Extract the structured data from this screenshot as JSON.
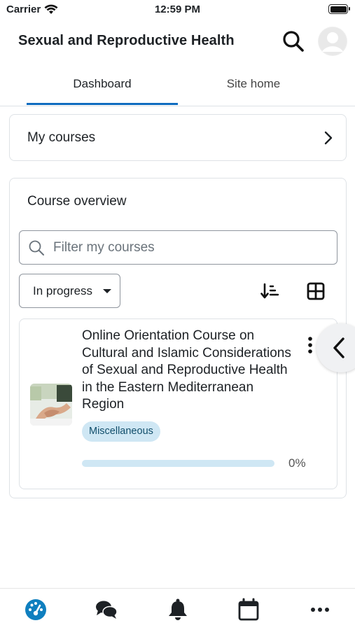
{
  "status_bar": {
    "carrier": "Carrier",
    "time": "12:59 PM"
  },
  "header": {
    "title": "Sexual and Reproductive Health",
    "search_icon": "search-icon",
    "avatar_icon": "user-avatar-icon"
  },
  "tabs": [
    {
      "label": "Dashboard",
      "active": true
    },
    {
      "label": "Site home",
      "active": false
    }
  ],
  "my_courses": {
    "label": "My courses"
  },
  "course_overview": {
    "heading": "Course overview",
    "filter_placeholder": "Filter my courses",
    "filter_value": "",
    "status_select": "In progress",
    "courses": [
      {
        "title": "Online Orientation Course on Cultural and Islamic Considerations of Sexual and Reproductive Health in the Eastern Mediterranean Region",
        "category": "Miscellaneous",
        "progress_percent": 0,
        "progress_label": "0%"
      }
    ]
  },
  "bottom_nav": [
    {
      "name": "dashboard",
      "icon": "dashboard-gauge-icon",
      "active": true
    },
    {
      "name": "messages",
      "icon": "chat-bubbles-icon",
      "active": false
    },
    {
      "name": "notifications",
      "icon": "bell-icon",
      "active": false
    },
    {
      "name": "calendar",
      "icon": "calendar-icon",
      "active": false
    },
    {
      "name": "more",
      "icon": "more-dots-icon",
      "active": false
    }
  ],
  "colors": {
    "accent": "#0f6cbf",
    "badge_bg": "#cfe7f4",
    "badge_text": "#114e6b",
    "border": "#dee2e6"
  }
}
